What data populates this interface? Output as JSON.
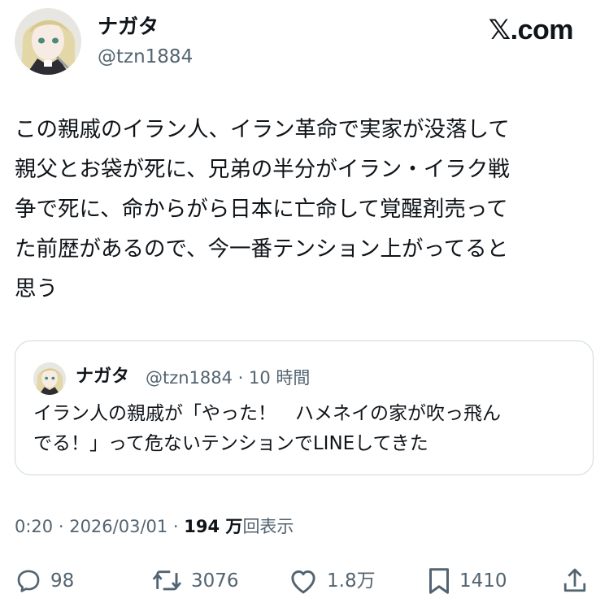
{
  "header": {
    "display_name": "ナガタ",
    "handle": "@tzn1884",
    "site_label": "𝕏.com"
  },
  "tweet": {
    "text": "この親戚のイラン人、イラン革命で実家が没落して\n親父とお袋が死に、兄弟の半分がイラン・イラク戦\n争で死に、命からがら日本に亡命して覚醒剤売って\nた前歴があるので、今一番テンション上がってると\n思う"
  },
  "quote": {
    "display_name": "ナガタ",
    "meta": "@tzn1884 · 10 時間",
    "text": "イラン人の親戚が「やった！　ハメネイの家が吹っ飛ん\nでる！」って危ないテンションでLINEしてきた"
  },
  "meta": {
    "time": "0:20",
    "separator": " · ",
    "date": "2026/03/01",
    "views_value": "194 万",
    "views_label": "回表示"
  },
  "actions": {
    "reply": {
      "icon": "reply-icon",
      "count": "98"
    },
    "retweet": {
      "icon": "retweet-icon",
      "count": "3076"
    },
    "like": {
      "icon": "heart-icon",
      "count": "1.8万"
    },
    "bookmark": {
      "icon": "bookmark-icon",
      "count": "1410"
    },
    "share": {
      "icon": "share-icon"
    }
  },
  "colors": {
    "text": "#0f1419",
    "secondary": "#536471",
    "border": "#cfd9de"
  }
}
